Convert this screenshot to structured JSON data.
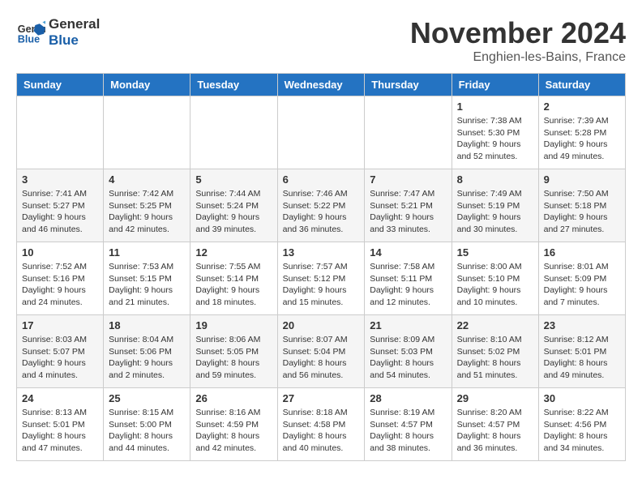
{
  "header": {
    "logo_line1": "General",
    "logo_line2": "Blue",
    "month": "November 2024",
    "location": "Enghien-les-Bains, France"
  },
  "weekdays": [
    "Sunday",
    "Monday",
    "Tuesday",
    "Wednesday",
    "Thursday",
    "Friday",
    "Saturday"
  ],
  "weeks": [
    [
      {
        "day": "",
        "info": ""
      },
      {
        "day": "",
        "info": ""
      },
      {
        "day": "",
        "info": ""
      },
      {
        "day": "",
        "info": ""
      },
      {
        "day": "",
        "info": ""
      },
      {
        "day": "1",
        "info": "Sunrise: 7:38 AM\nSunset: 5:30 PM\nDaylight: 9 hours\nand 52 minutes."
      },
      {
        "day": "2",
        "info": "Sunrise: 7:39 AM\nSunset: 5:28 PM\nDaylight: 9 hours\nand 49 minutes."
      }
    ],
    [
      {
        "day": "3",
        "info": "Sunrise: 7:41 AM\nSunset: 5:27 PM\nDaylight: 9 hours\nand 46 minutes."
      },
      {
        "day": "4",
        "info": "Sunrise: 7:42 AM\nSunset: 5:25 PM\nDaylight: 9 hours\nand 42 minutes."
      },
      {
        "day": "5",
        "info": "Sunrise: 7:44 AM\nSunset: 5:24 PM\nDaylight: 9 hours\nand 39 minutes."
      },
      {
        "day": "6",
        "info": "Sunrise: 7:46 AM\nSunset: 5:22 PM\nDaylight: 9 hours\nand 36 minutes."
      },
      {
        "day": "7",
        "info": "Sunrise: 7:47 AM\nSunset: 5:21 PM\nDaylight: 9 hours\nand 33 minutes."
      },
      {
        "day": "8",
        "info": "Sunrise: 7:49 AM\nSunset: 5:19 PM\nDaylight: 9 hours\nand 30 minutes."
      },
      {
        "day": "9",
        "info": "Sunrise: 7:50 AM\nSunset: 5:18 PM\nDaylight: 9 hours\nand 27 minutes."
      }
    ],
    [
      {
        "day": "10",
        "info": "Sunrise: 7:52 AM\nSunset: 5:16 PM\nDaylight: 9 hours\nand 24 minutes."
      },
      {
        "day": "11",
        "info": "Sunrise: 7:53 AM\nSunset: 5:15 PM\nDaylight: 9 hours\nand 21 minutes."
      },
      {
        "day": "12",
        "info": "Sunrise: 7:55 AM\nSunset: 5:14 PM\nDaylight: 9 hours\nand 18 minutes."
      },
      {
        "day": "13",
        "info": "Sunrise: 7:57 AM\nSunset: 5:12 PM\nDaylight: 9 hours\nand 15 minutes."
      },
      {
        "day": "14",
        "info": "Sunrise: 7:58 AM\nSunset: 5:11 PM\nDaylight: 9 hours\nand 12 minutes."
      },
      {
        "day": "15",
        "info": "Sunrise: 8:00 AM\nSunset: 5:10 PM\nDaylight: 9 hours\nand 10 minutes."
      },
      {
        "day": "16",
        "info": "Sunrise: 8:01 AM\nSunset: 5:09 PM\nDaylight: 9 hours\nand 7 minutes."
      }
    ],
    [
      {
        "day": "17",
        "info": "Sunrise: 8:03 AM\nSunset: 5:07 PM\nDaylight: 9 hours\nand 4 minutes."
      },
      {
        "day": "18",
        "info": "Sunrise: 8:04 AM\nSunset: 5:06 PM\nDaylight: 9 hours\nand 2 minutes."
      },
      {
        "day": "19",
        "info": "Sunrise: 8:06 AM\nSunset: 5:05 PM\nDaylight: 8 hours\nand 59 minutes."
      },
      {
        "day": "20",
        "info": "Sunrise: 8:07 AM\nSunset: 5:04 PM\nDaylight: 8 hours\nand 56 minutes."
      },
      {
        "day": "21",
        "info": "Sunrise: 8:09 AM\nSunset: 5:03 PM\nDaylight: 8 hours\nand 54 minutes."
      },
      {
        "day": "22",
        "info": "Sunrise: 8:10 AM\nSunset: 5:02 PM\nDaylight: 8 hours\nand 51 minutes."
      },
      {
        "day": "23",
        "info": "Sunrise: 8:12 AM\nSunset: 5:01 PM\nDaylight: 8 hours\nand 49 minutes."
      }
    ],
    [
      {
        "day": "24",
        "info": "Sunrise: 8:13 AM\nSunset: 5:01 PM\nDaylight: 8 hours\nand 47 minutes."
      },
      {
        "day": "25",
        "info": "Sunrise: 8:15 AM\nSunset: 5:00 PM\nDaylight: 8 hours\nand 44 minutes."
      },
      {
        "day": "26",
        "info": "Sunrise: 8:16 AM\nSunset: 4:59 PM\nDaylight: 8 hours\nand 42 minutes."
      },
      {
        "day": "27",
        "info": "Sunrise: 8:18 AM\nSunset: 4:58 PM\nDaylight: 8 hours\nand 40 minutes."
      },
      {
        "day": "28",
        "info": "Sunrise: 8:19 AM\nSunset: 4:57 PM\nDaylight: 8 hours\nand 38 minutes."
      },
      {
        "day": "29",
        "info": "Sunrise: 8:20 AM\nSunset: 4:57 PM\nDaylight: 8 hours\nand 36 minutes."
      },
      {
        "day": "30",
        "info": "Sunrise: 8:22 AM\nSunset: 4:56 PM\nDaylight: 8 hours\nand 34 minutes."
      }
    ]
  ]
}
